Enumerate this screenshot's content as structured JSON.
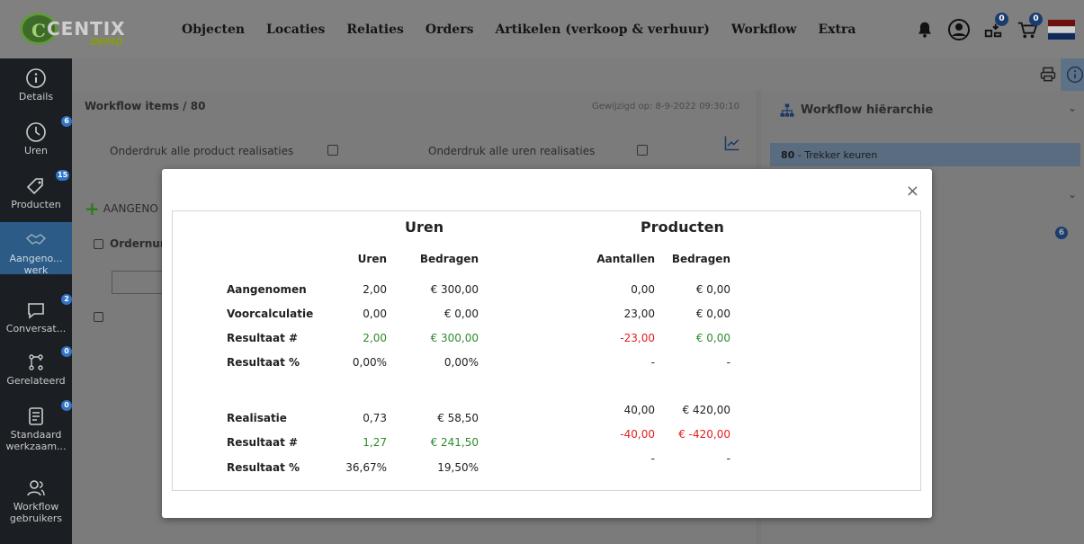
{
  "app": {
    "logo_text": "CENTIX",
    "logo_demo": "DEMO"
  },
  "nav": [
    {
      "label": "Objecten"
    },
    {
      "label": "Locaties"
    },
    {
      "label": "Relaties"
    },
    {
      "label": "Orders"
    },
    {
      "label": "Artikelen (verkoop & verhuur)"
    },
    {
      "label": "Workflow"
    },
    {
      "label": "Extra"
    }
  ],
  "top_icons": {
    "bell": {
      "icon": "bell-icon"
    },
    "user": {
      "icon": "user-icon"
    },
    "scan": {
      "icon": "scan-icon",
      "badge": "0"
    },
    "cart": {
      "icon": "cart-icon",
      "badge": "0"
    },
    "flag": {
      "icon": "dutch-flag-icon"
    }
  },
  "sidebar": [
    {
      "label": "Details",
      "icon": "info-icon",
      "badge": ""
    },
    {
      "label": "Uren",
      "icon": "clock-icon",
      "badge": "6"
    },
    {
      "label": "Producten",
      "icon": "tag-icon",
      "badge": "15"
    },
    {
      "label": "Aangeno... werk",
      "icon": "handshake-icon",
      "badge": ""
    },
    {
      "label": "Conversat...",
      "icon": "chat-icon",
      "badge": "2"
    },
    {
      "label": "Gerelateerd",
      "icon": "relation-icon",
      "badge": "0"
    },
    {
      "label": "Standaard werkzaam...",
      "icon": "document-icon",
      "badge": "0"
    },
    {
      "label": "Workflow gebruikers",
      "icon": "users-icon",
      "badge": ""
    }
  ],
  "background": {
    "breadcrumb": "Workflow items /  80",
    "modified": "Gewijzigd op: 8-9-2022 09:30:10",
    "suppress_products": "Onderdruk alle product realisaties",
    "suppress_hours": "Onderdruk alle uren realisaties",
    "add_button": "AANGENO",
    "order_col": "Ordernumm",
    "hierarchy_title": "Workflow hiërarchie",
    "hierarchy_item_num": "80",
    "hierarchy_item_label": " - Trekker keuren",
    "hierarchy_badge": "6"
  },
  "modal": {
    "close": "×",
    "section_uren": "Uren",
    "section_producten": "Producten",
    "col_uren": "Uren",
    "col_bedragen": "Bedragen",
    "col_aantallen": "Aantallen",
    "col_bedragen2": "Bedragen",
    "rows": [
      {
        "label": "Aangenomen",
        "uren": "2,00",
        "uren_bedrag": "€ 300,00",
        "aantal": "0,00",
        "prod_bedrag": "€ 0,00"
      },
      {
        "label": "Voorcalculatie",
        "uren": "0,00",
        "uren_bedrag": "€ 0,00",
        "aantal": "23,00",
        "prod_bedrag": "€ 0,00"
      },
      {
        "label": "Resultaat #",
        "uren": "2,00",
        "uren_bedrag": "€ 300,00",
        "aantal": "-23,00",
        "prod_bedrag": "€ 0,00"
      },
      {
        "label": "Resultaat %",
        "uren": "0,00%",
        "uren_bedrag": "0,00%",
        "aantal": "-",
        "prod_bedrag": "-"
      },
      {
        "label": "Realisatie",
        "uren": "0,73",
        "uren_bedrag": "€ 58,50",
        "aantal": "40,00",
        "prod_bedrag": "€ 420,00"
      },
      {
        "label": "Resultaat #",
        "uren": "1,27",
        "uren_bedrag": "€ 241,50",
        "aantal": "-40,00",
        "prod_bedrag": "€ -420,00"
      },
      {
        "label": "Resultaat %",
        "uren": "36,67%",
        "uren_bedrag": "19,50%",
        "aantal": "-",
        "prod_bedrag": "-"
      }
    ],
    "colors": {
      "positive": "#2e8b2e",
      "negative": "#e02020"
    }
  }
}
